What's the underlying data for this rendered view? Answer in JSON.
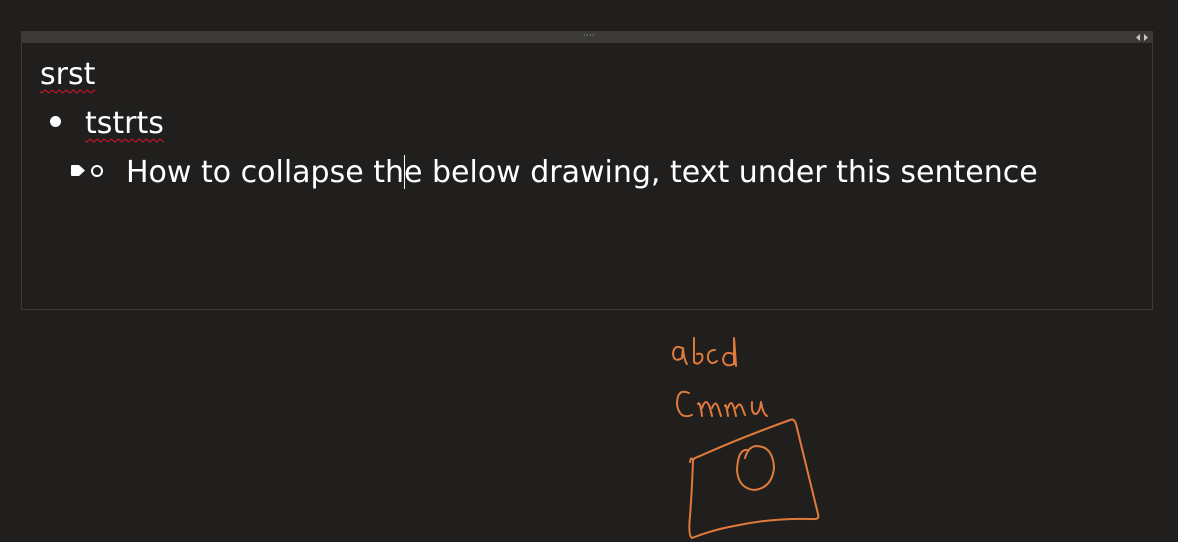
{
  "note": {
    "title": "srst",
    "bullet_text": "tstrts",
    "sub_bullet_text_before_cursor": "How to collapse th",
    "sub_bullet_text_after_cursor": "e below drawing, text under this sentence"
  },
  "container": {
    "grip_glyph": "····"
  },
  "ink": {
    "handwriting_line1": "abcd",
    "handwriting_line2": "cmmu",
    "color": "#e07a3a"
  },
  "colors": {
    "background": "#201f1e",
    "text": "#ffffff",
    "spellcheck": "#e81123"
  }
}
